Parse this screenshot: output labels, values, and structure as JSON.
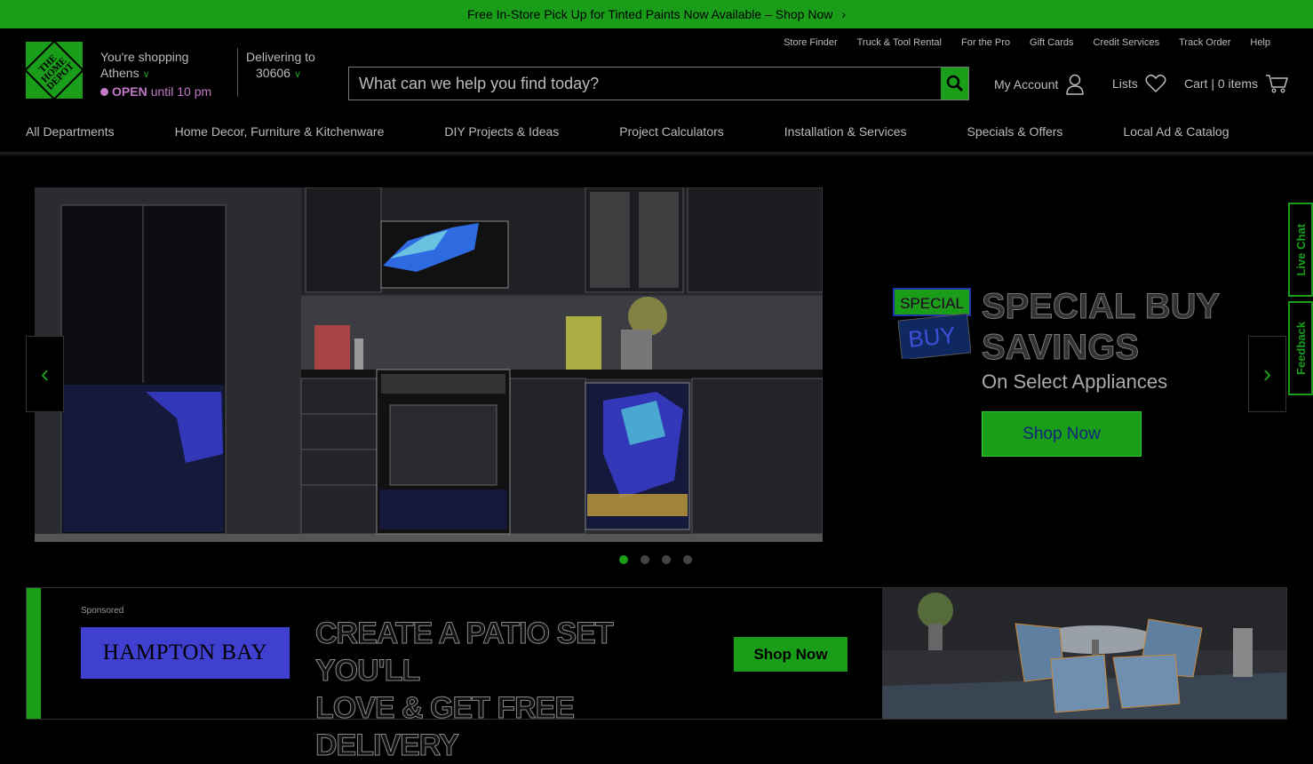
{
  "promo_bar": {
    "text": "Free In-Store Pick Up for Tinted Paints Now Available – Shop Now"
  },
  "logo": {
    "text": "THE HOME DEPOT"
  },
  "store": {
    "line1": "You're shopping",
    "city": "Athens",
    "open_label": "OPEN",
    "hours": "until 10 pm"
  },
  "delivery": {
    "label": "Delivering to",
    "zip": "30606"
  },
  "top_links": [
    "Store Finder",
    "Truck & Tool Rental",
    "For the Pro",
    "Gift Cards",
    "Credit Services",
    "Track Order",
    "Help"
  ],
  "search": {
    "placeholder": "What can we help you find today?"
  },
  "account": {
    "my_account": "My Account",
    "lists": "Lists",
    "cart": "Cart | 0 items"
  },
  "nav": [
    "All Departments",
    "Home Decor, Furniture & Kitchenware",
    "DIY Projects & Ideas",
    "Project Calculators",
    "Installation & Services",
    "Specials & Offers",
    "Local Ad & Catalog"
  ],
  "hero": {
    "badge_top": "SPECIAL",
    "badge_bottom": "BUY",
    "title_line1": "SPECIAL BUY",
    "title_line2": "SAVINGS",
    "subtitle": "On Select Appliances",
    "cta": "Shop Now",
    "slide_count": 4,
    "active_slide": 1
  },
  "side_tabs": {
    "chat": "Live Chat",
    "feedback": "Feedback"
  },
  "ad": {
    "sponsored": "Sponsored",
    "brand": "HAMPTON BAY",
    "headline_line1": "CREATE A PATIO SET YOU'LL",
    "headline_line2": "LOVE & GET FREE DELIVERY",
    "cta": "Shop Now"
  },
  "colors": {
    "brand_green": "#1a9e1a",
    "open_purple": "#c07ac6"
  }
}
